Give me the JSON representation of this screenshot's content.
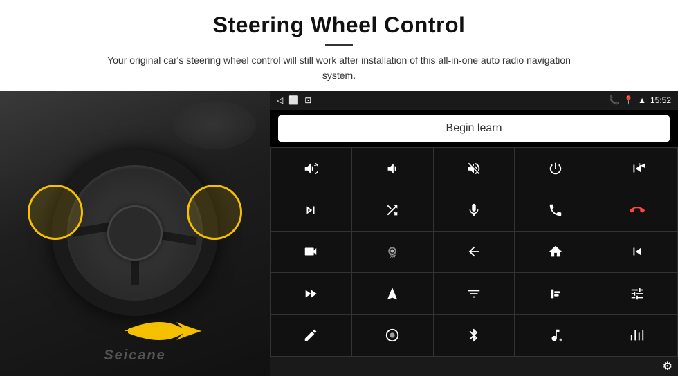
{
  "header": {
    "title": "Steering Wheel Control",
    "subtitle": "Your original car's steering wheel control will still work after installation of this all-in-one auto radio navigation system."
  },
  "status_bar": {
    "time": "15:52",
    "nav_back": "◁",
    "nav_home": "□",
    "nav_square": "⊡"
  },
  "begin_learn": {
    "label": "Begin learn"
  },
  "grid_rows": [
    [
      "vol+",
      "vol-",
      "vol-mute",
      "power",
      "prev-track"
    ],
    [
      "next",
      "shuffle-next",
      "mic",
      "phone",
      "hang-up"
    ],
    [
      "camera",
      "360-view",
      "back",
      "home",
      "skip-back"
    ],
    [
      "fast-forward",
      "navigate",
      "eq",
      "record",
      "settings-sliders"
    ],
    [
      "pen",
      "circle-btn",
      "bluetooth",
      "music-settings",
      "equalizer"
    ]
  ],
  "seicane": "Seicane",
  "gear": "⚙"
}
